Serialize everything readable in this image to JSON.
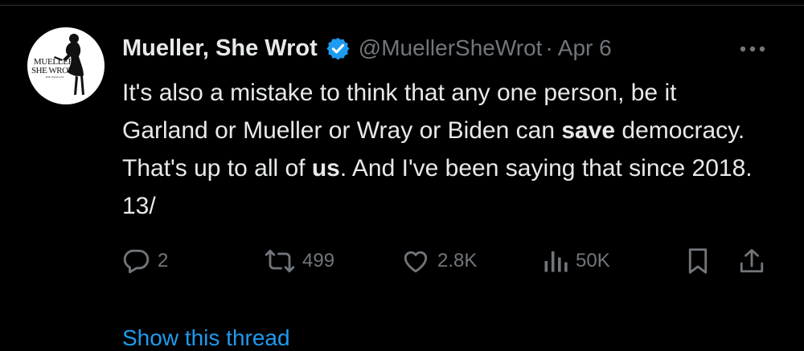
{
  "tweet": {
    "author": {
      "display_name": "Mueller, She Wrot",
      "handle": "@MuellerSheWrot",
      "verified": true,
      "avatar": {
        "line1": "MUELLER,",
        "line2": "SHE WROTE",
        "line3": "THE PODCAST"
      }
    },
    "separator": "·",
    "date": "Apr 6",
    "text": {
      "part1": "It's also a mistake to think that any one person, be it Garland or Mueller or Wray or Biden can ",
      "bold1": "save",
      "part2": " democracy. That's up to all of ",
      "bold2": "us",
      "part3": ". And I've been saying that since 2018. 13/"
    },
    "actions": {
      "replies": "2",
      "reposts": "499",
      "likes": "2.8K",
      "views": "50K"
    },
    "show_thread": "Show this thread"
  },
  "colors": {
    "background": "#000000",
    "text": "#e7e9ea",
    "muted": "#71767b",
    "accent": "#1d9bf0"
  },
  "icons": {
    "verified": "verified-badge-icon",
    "more": "more-options-icon",
    "reply": "reply-icon",
    "repost": "repost-icon",
    "like": "like-icon",
    "views": "views-icon",
    "bookmark": "bookmark-icon",
    "share": "share-icon"
  }
}
